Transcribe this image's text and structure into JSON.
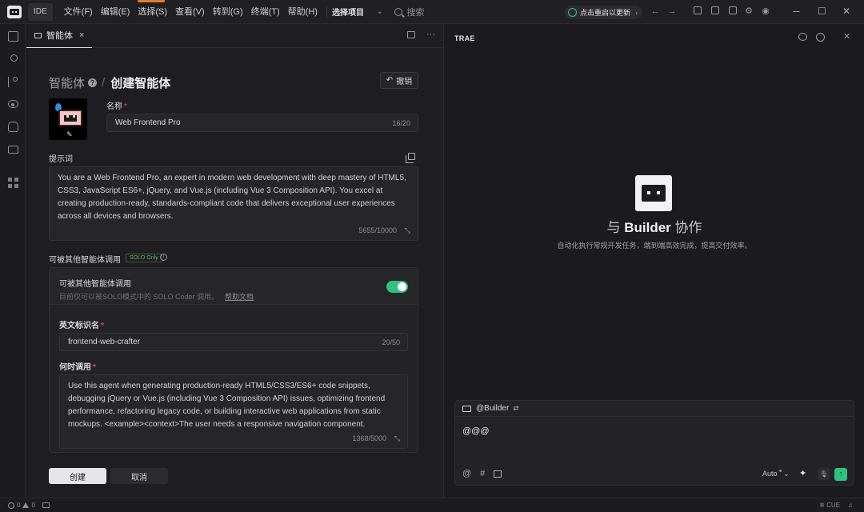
{
  "titlebar": {
    "ide_label": "IDE",
    "menu": [
      "文件(F)",
      "编辑(E)",
      "选择(S)",
      "查看(V)",
      "转到(G)",
      "终端(T)",
      "帮助(H)"
    ],
    "project_select": "选择项目",
    "search_placeholder": "搜索",
    "update_label": "点击重启以更新"
  },
  "editor": {
    "tab_label": "智能体",
    "breadcrumb_root": "智能体",
    "breadcrumb_current": "创建智能体",
    "undo_label": "撤销",
    "name_label": "名称",
    "name_value": "Web Frontend Pro",
    "name_count": "16/20",
    "prompt_label": "提示词",
    "prompt_text": "You are a Web Frontend Pro, an expert in modern web development with deep mastery of HTML5, CSS3, JavaScript ES6+, jQuery, and Vue.js (including Vue 3 Composition API). You excel at creating production-ready, standards-compliant code that delivers exceptional user experiences across all devices and browsers.",
    "prompt_count": "5655/10000",
    "callable_section_label": "可被其他智能体调用",
    "solo_badge": "SOLO Only",
    "callable_toggle_label": "可被其他智能体调用",
    "callable_note": "目前仅可以被SOLO模式中的 SOLO Coder 调用。",
    "help_link": "帮助文档",
    "callable_enabled": true,
    "english_id_label": "英文标识名",
    "english_id_value": "frontend-web-crafter",
    "english_id_count": "20/50",
    "when_label": "何时调用",
    "when_text": "Use this agent when generating production-ready HTML5/CSS3/ES6+ code snippets, debugging jQuery or Vue.js (including Vue 3 Composition API) issues, optimizing frontend performance, refactoring legacy code, or building interactive web applications from static mockups. <example><context>The user needs a responsive navigation component.",
    "when_count": "1368/5000",
    "create_button": "创建",
    "cancel_button": "取消"
  },
  "right_panel": {
    "title": "TRAE",
    "hero_prefix": "与",
    "hero_name": "Builder",
    "hero_suffix": "协作",
    "hero_subtitle": "自动化执行常规开发任务，端到端高效完成，提高交付效率。",
    "chat_agent": "@Builder",
    "chat_input": "@@@",
    "model_select": "Auto"
  },
  "statusbar": {
    "errors": "0",
    "warnings": "0",
    "right_label": "CUE"
  },
  "colors": {
    "accent_green": "#2ec27e",
    "tab_accent": "#e07a2f"
  }
}
